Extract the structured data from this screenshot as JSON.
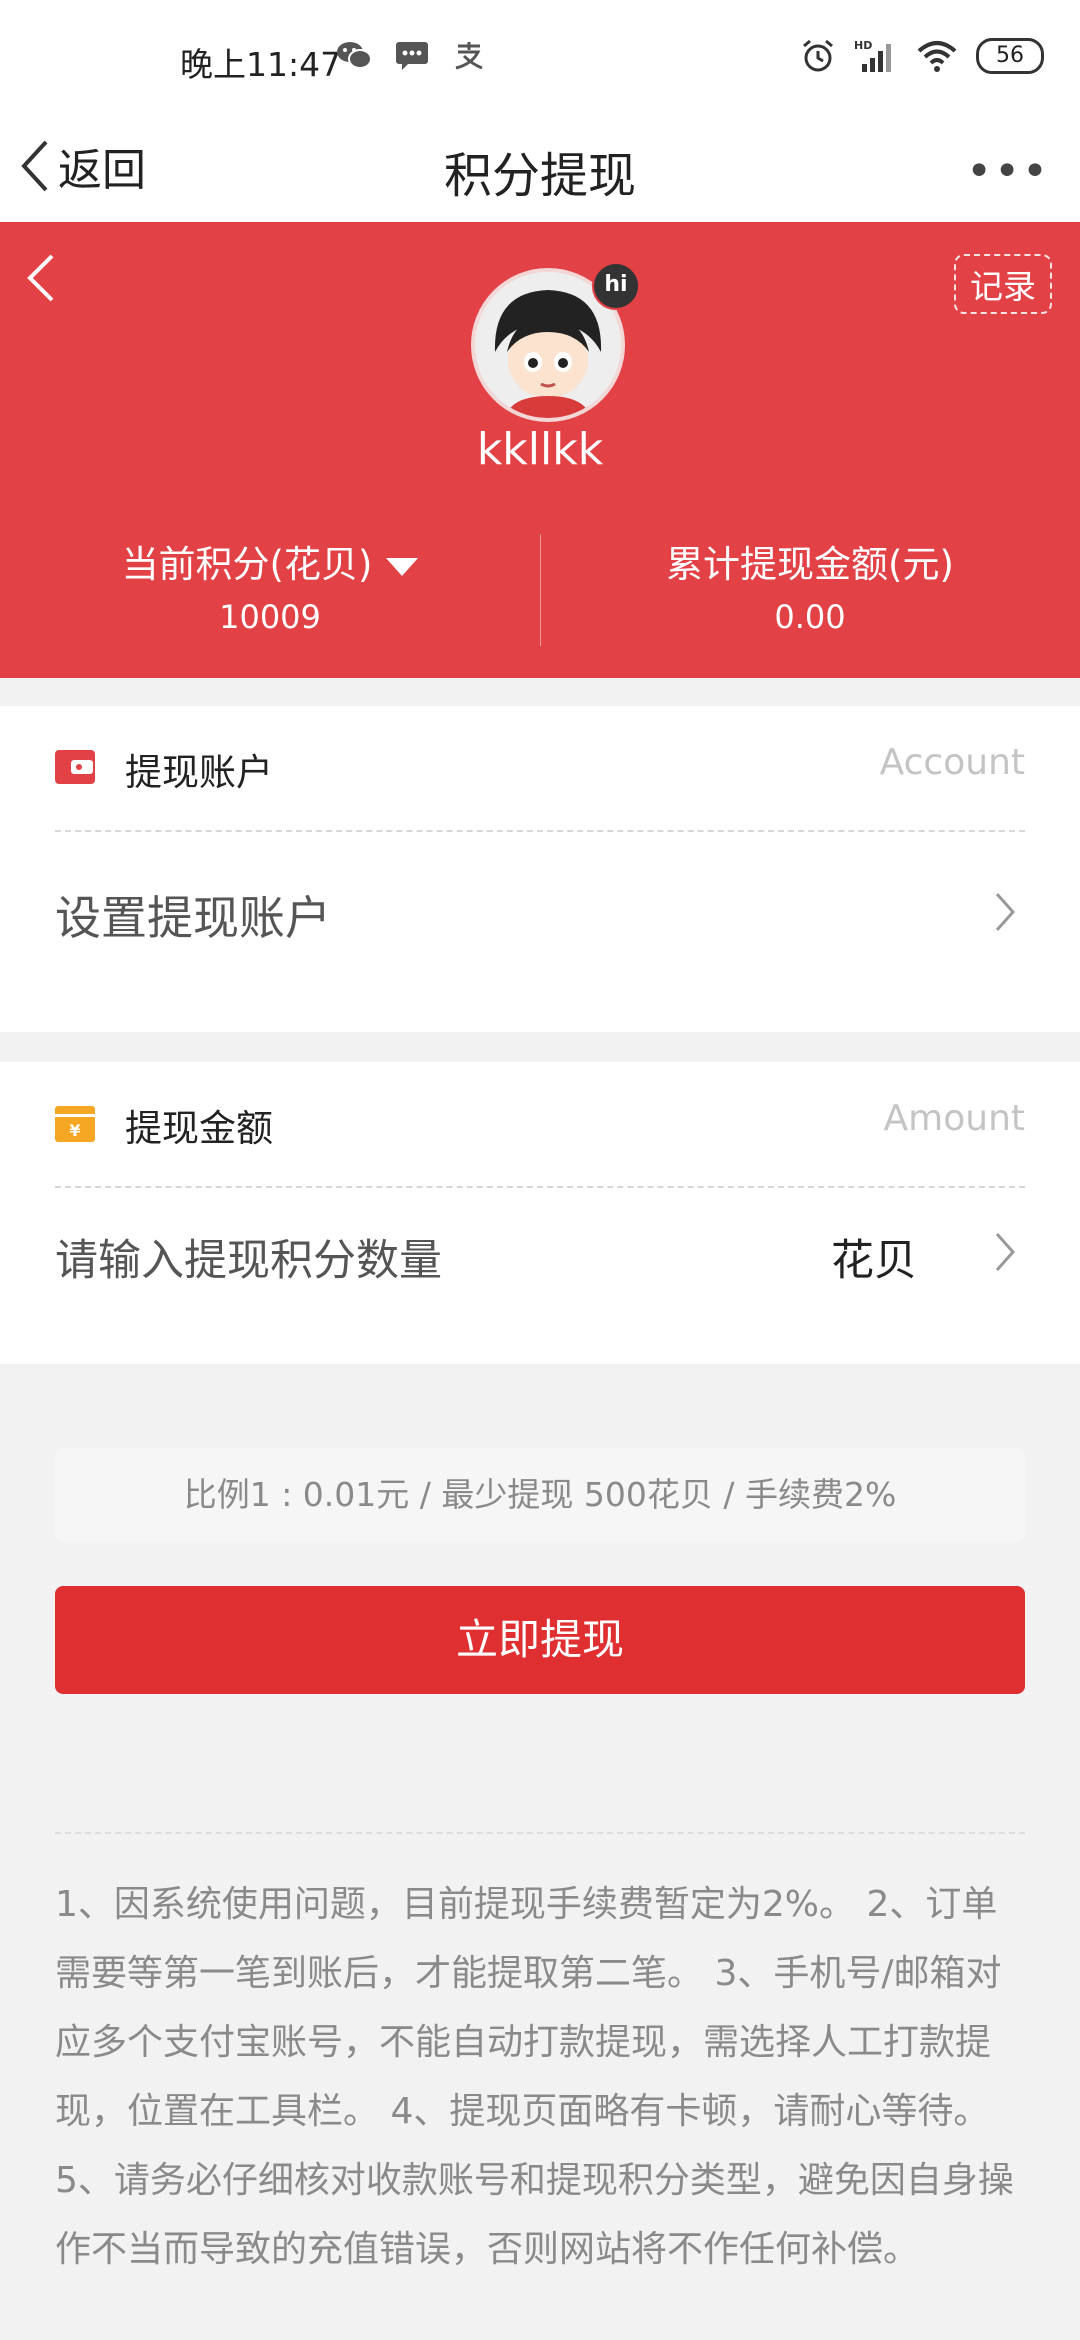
{
  "status_bar": {
    "time": "晚上11:47",
    "left_icons": [
      "wechat-icon",
      "message-icon",
      "alipay-icon"
    ],
    "right_icons": [
      "alarm-icon",
      "hd-signal-icon",
      "wifi-icon"
    ],
    "battery": "56"
  },
  "nav": {
    "back_label": "返回",
    "title": "积分提现",
    "more_label": "•••"
  },
  "hero": {
    "record_label": "记录",
    "hi_badge": "hi",
    "username": "kkllkk",
    "points_label": "当前积分(花贝)",
    "points_value": "10009",
    "total_label": "累计提现金额(元)",
    "total_value": "0.00",
    "bg_color": "#e24146"
  },
  "account_card": {
    "title": "提现账户",
    "hint": "Account",
    "row_label": "设置提现账户"
  },
  "amount_card": {
    "title": "提现金额",
    "hint": "Amount",
    "placeholder": "请输入提现积分数量",
    "unit": "花贝"
  },
  "ratio_text": "比例1 : 0.01元 / 最少提现 500花贝 / 手续费2%",
  "submit_label": "立即提现",
  "notes_text": "1、因系统使用问题，目前提现手续费暂定为2%。 2、订单需要等第一笔到账后，才能提取第二笔。 3、手机号/邮箱对应多个支付宝账号，不能自动打款提现，需选择人工打款提现，位置在工具栏。 4、提现页面略有卡顿，请耐心等待。 5、请务必仔细核对收款账号和提现积分类型，避免因自身操作不当而导致的充值错误，否则网站将不作任何补偿。",
  "colors": {
    "accent": "#df2f31",
    "wallet_icon": "#e24146",
    "money_icon": "#f5a623"
  }
}
